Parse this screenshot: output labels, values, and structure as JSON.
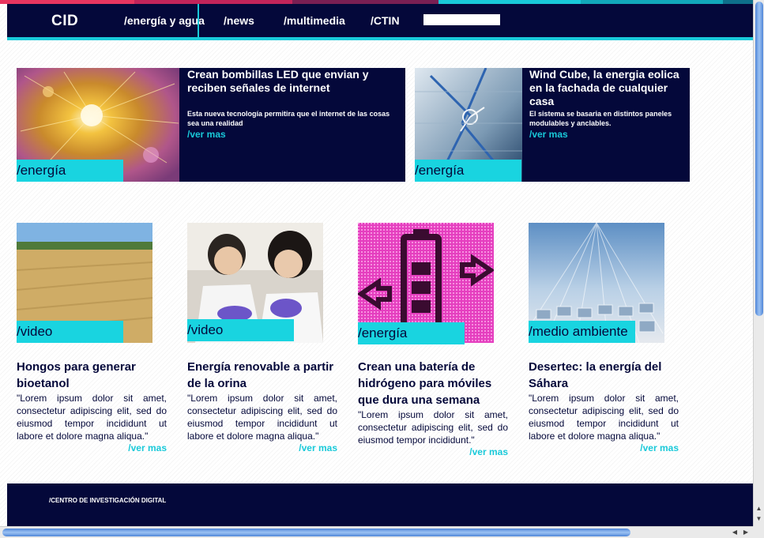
{
  "colors": {
    "navy": "#04083a",
    "cyan": "#19c9d9",
    "tag": "#19d4e0"
  },
  "nav": {
    "logo": "CID",
    "items": [
      "/energía y agua",
      "/news",
      "/multimedia",
      "/CTIN"
    ],
    "search_value": ""
  },
  "featured": [
    {
      "tag": "/energía",
      "title": "Crean bombillas LED que envian y reciben señales de internet",
      "desc": "Esta nueva tecnología permitira que el internet de las cosas sea una realidad",
      "more": "/ver mas",
      "image": "fiber-optic-led-image"
    },
    {
      "tag": "/energía",
      "title": "Wind Cube, la energia eolica en la fachada de cualquier casa",
      "desc": "El sistema se basaria en distintos paneles modulables y anclables.",
      "more": "/ver mas",
      "image": "wind-cube-facade-image"
    }
  ],
  "cards": [
    {
      "tag": "/video",
      "title": "Hongos para generar bioetanol",
      "text": "\"Lorem ipsum dolor sit amet, consectetur adipiscing elit, sed do eiusmod tempor incididunt ut labore et dolore magna aliqua.\"",
      "more": "/ver mas",
      "image": "wheat-field-image"
    },
    {
      "tag": "/video",
      "title": "Energía renovable a partir de la orina",
      "text": "\"Lorem ipsum dolor sit amet, consectetur adipiscing elit, sed do eiusmod tempor incididunt ut labore et dolore magna aliqua.\"",
      "more": "/ver mas",
      "image": "lab-researchers-image"
    },
    {
      "tag": "/energía",
      "title": "Crean una batería de hidrógeno para móviles que dura una semana",
      "text": "\"Lorem ipsum dolor sit amet, consectetur adipiscing elit, sed do eiusmod tempor incididunt.\"",
      "more": "/ver mas",
      "image": "battery-icon-image"
    },
    {
      "tag": "/medio ambiente",
      "title": "Desertec: la energía del Sáhara",
      "text": "\"Lorem ipsum dolor sit amet, consectetur adipiscing elit, sed do eiusmod tempor incididunt ut labore et dolore magna aliqua.\"",
      "more": "/ver mas",
      "image": "solar-mirrors-image"
    }
  ],
  "footer": {
    "text": "/CENTRO DE INVESTIGACIÓN DIGITAL"
  }
}
